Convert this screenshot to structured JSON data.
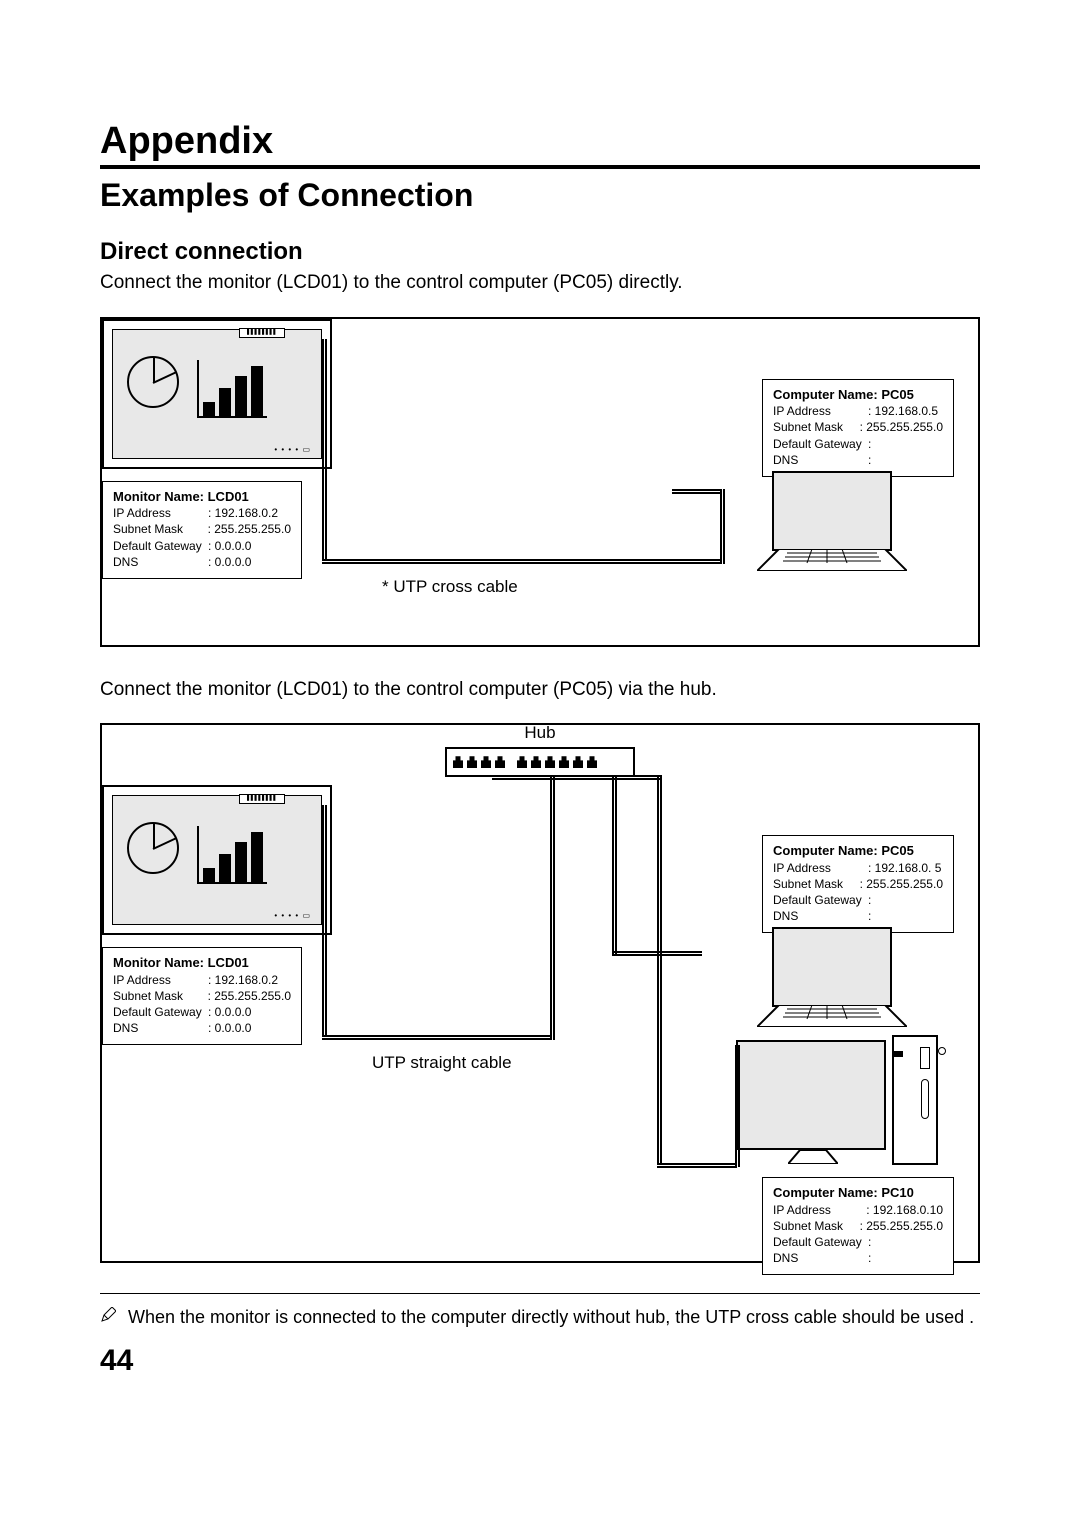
{
  "headings": {
    "h1": "Appendix",
    "h2": "Examples of Connection",
    "h3": "Direct connection"
  },
  "text": {
    "p1": "Connect the monitor (LCD01) to the control computer (PC05) directly.",
    "p2": "Connect the monitor (LCD01) to the control computer (PC05) via the hub.",
    "footnote": "When the monitor is connected to the computer directly without hub, the UTP cross cable should be used .",
    "page": "44"
  },
  "diagram1": {
    "monitor": {
      "title": "Monitor Name: LCD01",
      "rows": [
        {
          "k": "IP Address",
          "v": "192.168.0.2"
        },
        {
          "k": "Subnet Mask",
          "v": "255.255.255.0"
        },
        {
          "k": "Default Gateway",
          "v": "0.0.0.0"
        },
        {
          "k": "DNS",
          "v": "0.0.0.0"
        }
      ]
    },
    "pc": {
      "title": "Computer Name: PC05",
      "rows": [
        {
          "k": "IP Address",
          "v": "192.168.0.5"
        },
        {
          "k": "Subnet Mask",
          "v": "255.255.255.0"
        },
        {
          "k": "Default Gateway",
          "v": ""
        },
        {
          "k": "DNS",
          "v": ""
        }
      ]
    },
    "cable_label": "* UTP cross cable"
  },
  "diagram2": {
    "hub_label": "Hub",
    "cable_label": "UTP straight cable",
    "monitor": {
      "title": "Monitor Name: LCD01",
      "rows": [
        {
          "k": "IP Address",
          "v": "192.168.0.2"
        },
        {
          "k": "Subnet Mask",
          "v": "255.255.255.0"
        },
        {
          "k": "Default Gateway",
          "v": "0.0.0.0"
        },
        {
          "k": "DNS",
          "v": "0.0.0.0"
        }
      ]
    },
    "pc05": {
      "title": "Computer Name: PC05",
      "rows": [
        {
          "k": "IP Address",
          "v": "192.168.0. 5"
        },
        {
          "k": "Subnet Mask",
          "v": "255.255.255.0"
        },
        {
          "k": "Default Gateway",
          "v": ""
        },
        {
          "k": "DNS",
          "v": ""
        }
      ]
    },
    "pc10": {
      "title": "Computer Name: PC10",
      "rows": [
        {
          "k": "IP Address",
          "v": "192.168.0.10"
        },
        {
          "k": "Subnet Mask",
          "v": "255.255.255.0"
        },
        {
          "k": "Default Gateway",
          "v": ""
        },
        {
          "k": "DNS",
          "v": ""
        }
      ]
    }
  }
}
